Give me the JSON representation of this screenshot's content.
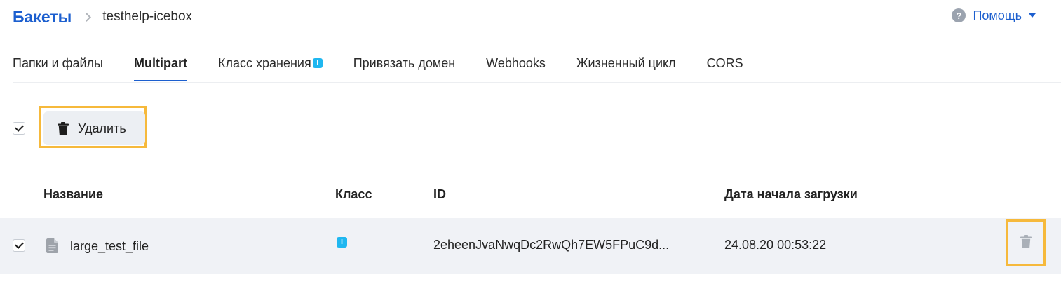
{
  "header": {
    "breadcrumb_root": "Бакеты",
    "breadcrumb_current": "testhelp-icebox",
    "help_label": "Помощь"
  },
  "tabs": [
    {
      "label": "Папки и файлы",
      "active": false
    },
    {
      "label": "Multipart",
      "active": true
    },
    {
      "label": "Класс хранения",
      "active": false,
      "badge": "I"
    },
    {
      "label": "Привязать домен",
      "active": false
    },
    {
      "label": "Webhooks",
      "active": false
    },
    {
      "label": "Жизненный цикл",
      "active": false
    },
    {
      "label": "CORS",
      "active": false
    }
  ],
  "toolbar": {
    "select_all_checked": true,
    "delete_label": "Удалить"
  },
  "table": {
    "columns": [
      "Название",
      "Класс",
      "ID",
      "Дата начала загрузки"
    ],
    "rows": [
      {
        "checked": true,
        "name": "large_test_file",
        "class_badge": "I",
        "id": "2eheenJvaNwqDc2RwQh7EW5FPuC9d...",
        "date": "24.08.20 00:53:22"
      }
    ]
  },
  "colors": {
    "accent": "#1c5fcf",
    "highlight": "#f6b93b",
    "badge": "#1fb7f0",
    "row_bg": "#f0f2f6"
  }
}
